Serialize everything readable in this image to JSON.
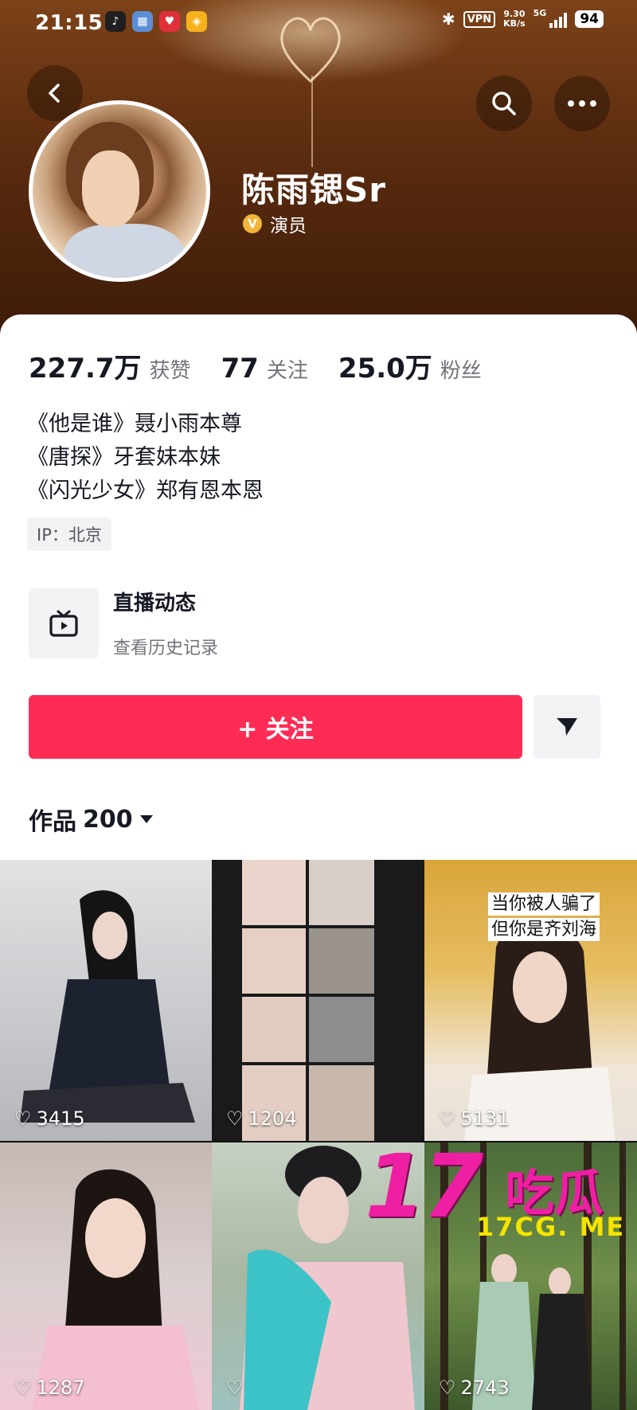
{
  "status_bar": {
    "time": "21:15",
    "vpn": "VPN",
    "net_speed": "9.30",
    "net_unit": "KB/s",
    "signal": "5G",
    "battery": "94"
  },
  "header": {
    "back_icon": "chevron-left-icon",
    "search_icon": "search-icon",
    "more_icon": "more-horizontal-icon"
  },
  "profile": {
    "name": "陈雨锶Sr",
    "verified_badge": "V",
    "verified_label": "演员",
    "verified_color": "#f2b53b"
  },
  "stats": [
    {
      "value": "227.7万",
      "label": "获赞"
    },
    {
      "value": "77",
      "label": "关注"
    },
    {
      "value": "25.0万",
      "label": "粉丝"
    }
  ],
  "bio": [
    "《他是谁》聂小雨本尊",
    "《唐探》牙套妹本妹",
    "《闪光少女》郑有恩本恩"
  ],
  "ip_label": "IP：北京",
  "live": {
    "title": "直播动态",
    "subtitle": "查看历史记录"
  },
  "actions": {
    "follow_label": "+ 关注",
    "follow_color": "#fe2c55"
  },
  "works": {
    "label": "作品",
    "count": "200"
  },
  "videos": [
    {
      "likes": "3415"
    },
    {
      "likes": "1204"
    },
    {
      "likes": "5131",
      "caption_lines": [
        "当你被人骗了",
        "但你是齐刘海"
      ]
    },
    {
      "likes": "1287"
    },
    {
      "likes": ""
    },
    {
      "likes": "2743"
    }
  ],
  "watermark": {
    "number": "17",
    "chinese": "吃瓜",
    "url": "17CG. ME"
  }
}
